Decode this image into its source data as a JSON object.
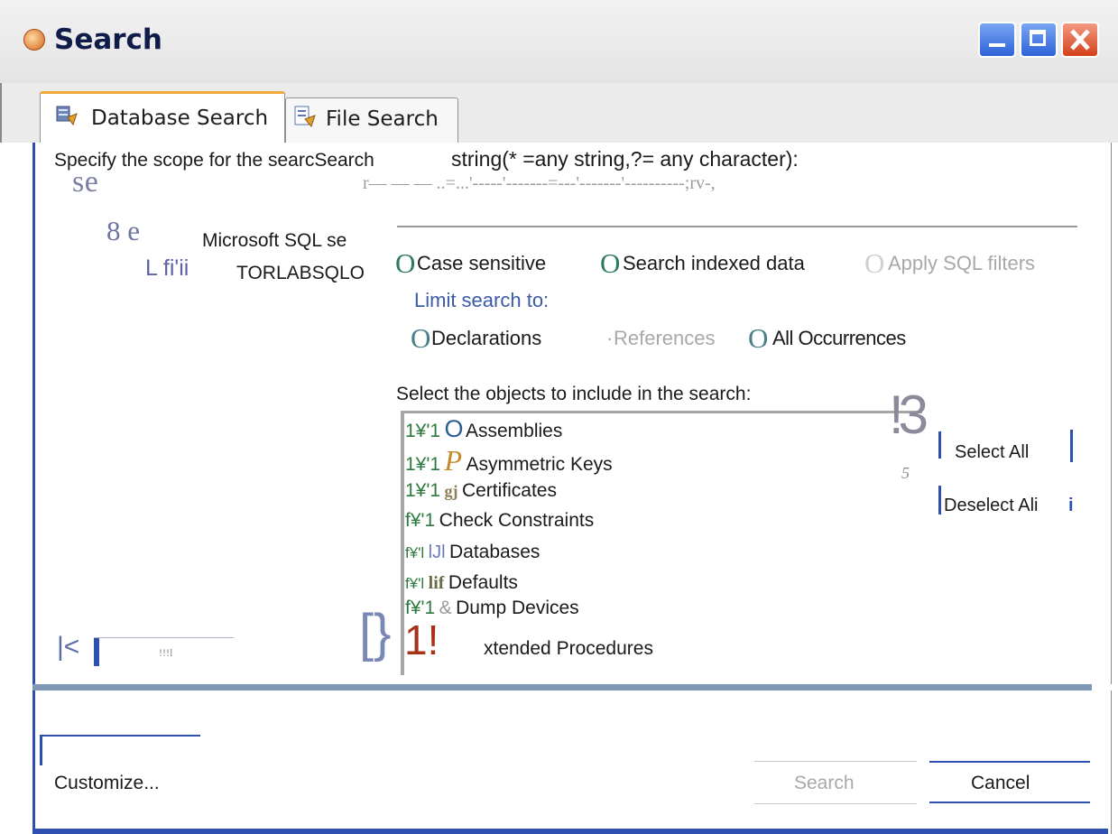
{
  "window": {
    "title": "Search"
  },
  "tabs": [
    {
      "label": "Database Search",
      "active": true
    },
    {
      "label": "File Search",
      "active": false
    }
  ],
  "scope": {
    "prompt": "Specify the scope for the searcSearch",
    "string_label": "string(* =any string,?= any character):",
    "artifact_se": "s e",
    "artifact_rule": "r— — — ..=...'-----'-------=---'-------'----------;rv-,",
    "tree": {
      "server_glyph": "8 e",
      "server_label": "Microsoft SQL se",
      "db_glyph": "L fi'ii",
      "db_label": "TORLABSQLO"
    }
  },
  "options": {
    "case_sensitive": "Case sensitive",
    "search_indexed": "Search indexed data",
    "apply_sql_filters": "Apply SQL filters",
    "radio_glyph": "O"
  },
  "limit": {
    "title": "Limit search to:",
    "declarations": "Declarations",
    "references": "References",
    "references_prefix": "·",
    "all_occurrences": "All Occurrences"
  },
  "objects": {
    "title": "Select the objects to include in the search:",
    "items": [
      {
        "check": "1¥'1",
        "icon": "O",
        "label": "Assemblies"
      },
      {
        "check": "1¥'1",
        "icon": "P",
        "label": "Asymmetric Keys"
      },
      {
        "check": "1¥'1",
        "icon": "gj",
        "label": "Certificates"
      },
      {
        "check": "f¥'1",
        "icon": "",
        "label": "Check Constraints"
      },
      {
        "check": "f¥'l",
        "icon": "lJl",
        "label": "Databases"
      },
      {
        "check": "f¥'l",
        "icon": "lif",
        "label": "Defaults"
      },
      {
        "check": "f¥'1",
        "icon": "&",
        "label": "Dump Devices"
      },
      {
        "check": "1!",
        "icon": "",
        "label": "xtended Procedures"
      }
    ],
    "side_glyph_top": "!3",
    "side_glyph_small": "5",
    "select_all": "Select All",
    "deselect_all": "Deselect Ali",
    "deselect_suffix": "i"
  },
  "left_controls": {
    "collapse": "|<",
    "mid_glyph": "!!!l",
    "brace": "[}"
  },
  "footer": {
    "customize": "Customize...",
    "search": "Search",
    "cancel": "Cancel"
  },
  "colors": {
    "accent_blue": "#2c4fb0",
    "radio_green": "#2e7a59",
    "disabled_gray": "#a8a8a8",
    "limit_blue": "#3b5aa8"
  }
}
